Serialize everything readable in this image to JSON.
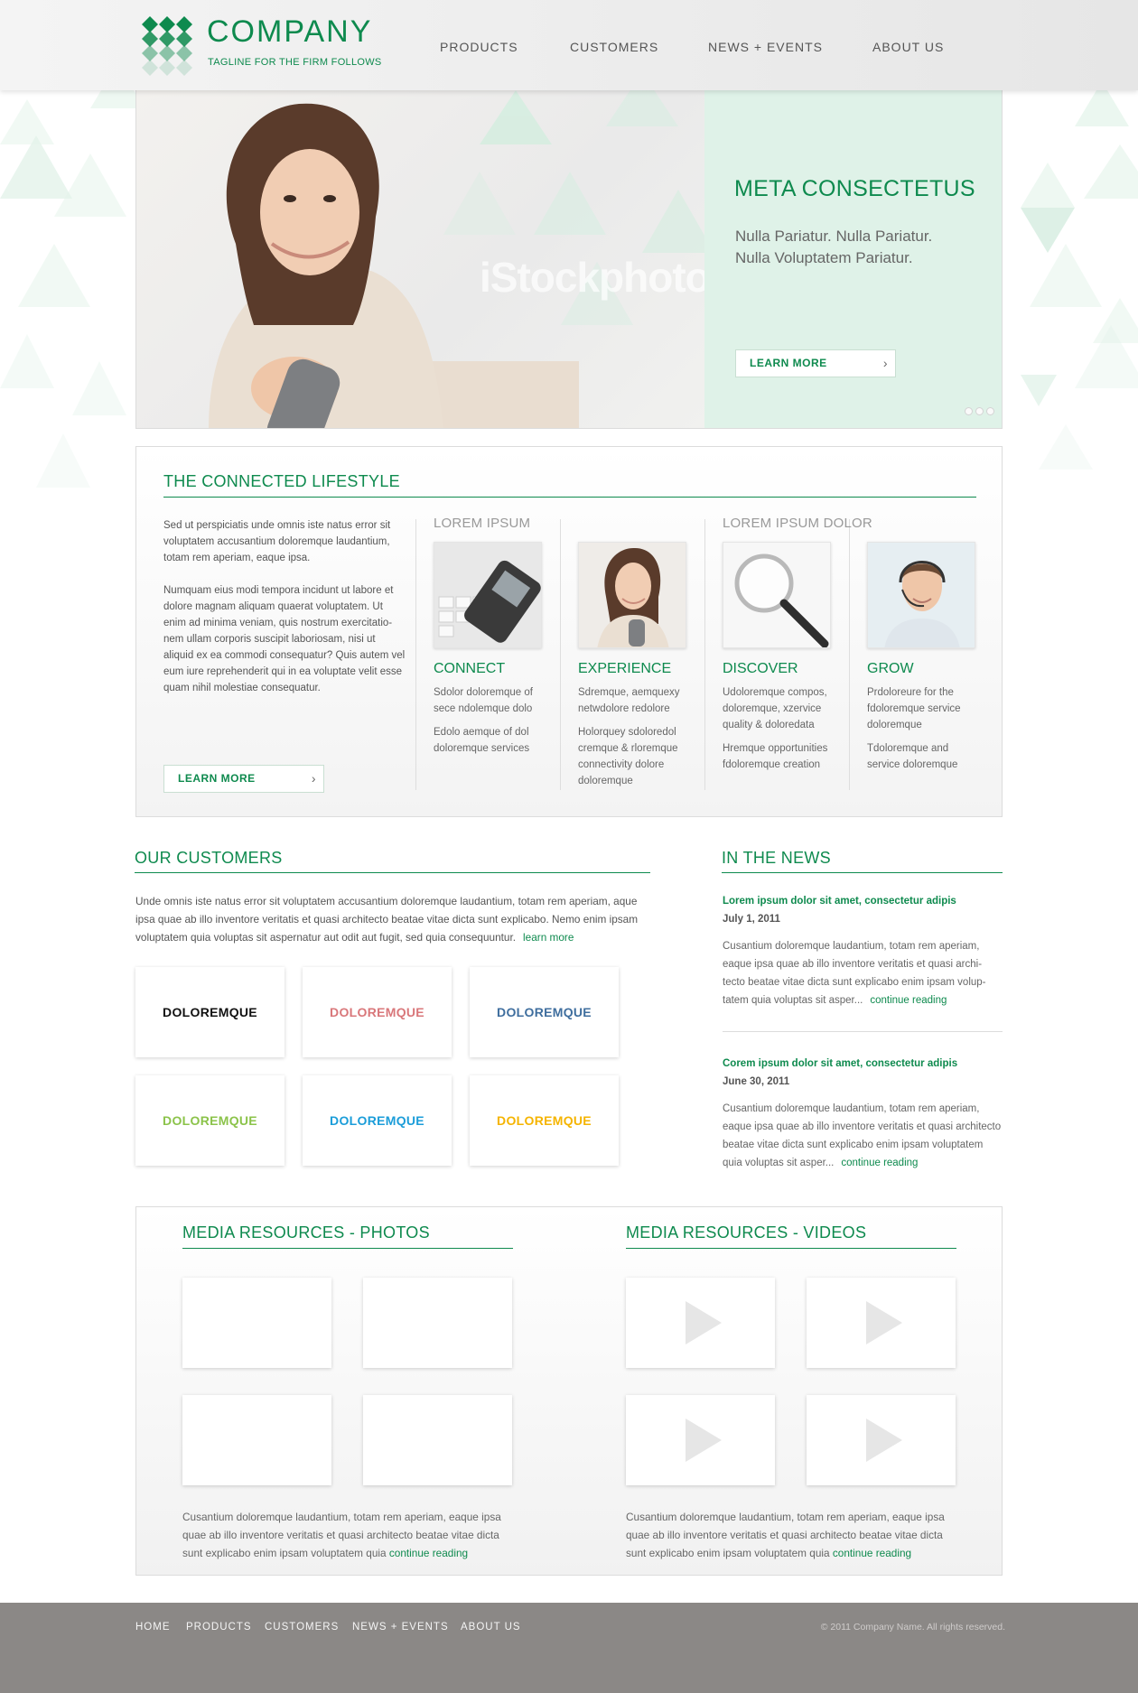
{
  "brand": {
    "name": "COMPANY",
    "tagline": "TAGLINE FOR THE FIRM FOLLOWS",
    "accent": "#0e8a4e"
  },
  "nav": [
    "PRODUCTS",
    "CUSTOMERS",
    "NEWS + EVENTS",
    "ABOUT US"
  ],
  "hero": {
    "watermark": "iStockphoto",
    "title": "META CONSECTETUS",
    "subtitle_line1": "Nulla Pariatur. Nulla Pariatur.",
    "subtitle_line2": "Nulla Voluptatem Pariatur.",
    "button": "LEARN MORE",
    "slides": 3
  },
  "lifestyle": {
    "title": "THE CONNECTED LIFESTYLE",
    "intro_p1": "Sed ut perspiciatis unde omnis iste natus error sit voluptatem accusantium doloremque laudantium, totam rem aperiam, eaque ipsa.",
    "intro_p2": "Numquam eius modi tempora incidunt ut labore et dolore magnam aliquam quaerat voluptatem. Ut enim ad minima veniam, quis nostrum exercitatio-nem ullam corporis suscipit laboriosam, nisi ut aliquid ex ea commodi consequatur? Quis autem vel eum iure reprehenderit qui in ea voluptate velit esse quam nihil molestiae consequatur.",
    "button": "LEARN MORE",
    "group1": "LOREM IPSUM",
    "group2": "LOREM IPSUM DOLOR",
    "features": [
      {
        "title": "CONNECT",
        "p1": "Sdolor doloremque of sece ndolemque dolo",
        "p2": "Edolo aemque of dol doloremque services",
        "icon": "phone-keyboard-photo"
      },
      {
        "title": "EXPERIENCE",
        "p1": "Sdremque, aemquexy netwdolore redolore",
        "p2": "Holorquey sdoloredol cremque & rloremque connectivity dolore doloremque",
        "icon": "woman-remote-photo"
      },
      {
        "title": "DISCOVER",
        "p1": "Udoloremque compos, doloremque, xzervice quality & doloredata",
        "p2": "Hremque opportunities fdoloremque creation",
        "icon": "magnifier-photo"
      },
      {
        "title": "GROW",
        "p1": "Prdoloreure for the fdoloremque service doloremque",
        "p2": "Tdoloremque and service doloremque",
        "icon": "headset-man-photo"
      }
    ]
  },
  "customers": {
    "title": "OUR CUSTOMERS",
    "text": "Unde omnis iste natus error sit voluptatem accusantium doloremque laudantium, totam rem aperiam, aque ipsa quae ab illo inventore veritatis et quasi architecto beatae vitae dicta sunt explicabo. Nemo enim ipsam voluptatem quia voluptas sit aspernatur aut odit aut fugit, sed quia consequuntur.",
    "link": "learn more",
    "logos": [
      {
        "label": "DOLOREMQUE",
        "color": "#111111"
      },
      {
        "label": "DOLOREMQUE",
        "color": "#d9777a"
      },
      {
        "label": "DOLOREMQUE",
        "color": "#3f6e9e"
      },
      {
        "label": "DOLOREMQUE",
        "color": "#8bc34a"
      },
      {
        "label": "DOLOREMQUE",
        "color": "#1b9dd9"
      },
      {
        "label": "DOLOREMQUE",
        "color": "#f5b400"
      }
    ]
  },
  "news": {
    "title": "IN THE NEWS",
    "items": [
      {
        "headline": "Lorem ipsum dolor sit amet, consectetur adipis",
        "date": "July 1, 2011",
        "body": "Cusantium doloremque laudantium, totam rem aperiam, eaque ipsa quae ab illo inventore veritatis et quasi archi-tecto beatae vitae dicta sunt explicabo enim ipsam volup-tatem quia voluptas sit asper...",
        "link": "continue reading"
      },
      {
        "headline": "Corem ipsum dolor sit amet, consectetur adipis",
        "date": "June 30, 2011",
        "body": "Cusantium doloremque laudantium, totam rem aperiam, eaque ipsa quae ab illo inventore veritatis et quasi architecto beatae vitae dicta sunt explicabo enim ipsam voluptatem quia voluptas sit asper...",
        "link": "continue reading"
      }
    ]
  },
  "media": {
    "photos_title": "MEDIA RESOURCES - PHOTOS",
    "videos_title": "MEDIA RESOURCES - VIDEOS",
    "photos_text": "Cusantium doloremque laudantium, totam rem aperiam, eaque ipsa quae ab illo inventore veritatis et quasi architecto beatae vitae dicta sunt explicabo enim ipsam voluptatem quia",
    "videos_text": "Cusantium doloremque laudantium, totam rem aperiam, eaque ipsa quae ab illo inventore veritatis et quasi architecto beatae vitae dicta sunt explicabo enim ipsam voluptatem quia",
    "link": "continue reading"
  },
  "footer": {
    "nav": [
      "HOME",
      "PRODUCTS",
      "CUSTOMERS",
      "NEWS + EVENTS",
      "ABOUT US"
    ],
    "copyright": "© 2011 Company Name. All rights reserved."
  }
}
